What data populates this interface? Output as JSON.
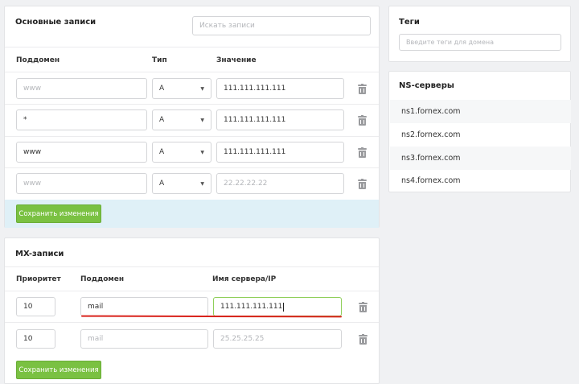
{
  "main_records": {
    "title": "Основные записи",
    "search_placeholder": "Искать записи",
    "columns": {
      "subdomain": "Поддомен",
      "type": "Тип",
      "value": "Значение"
    },
    "rows": [
      {
        "subdomain": "www",
        "subdomain_is_placeholder": true,
        "type": "A",
        "value": "111.111.111.111",
        "value_is_placeholder": false
      },
      {
        "subdomain": "*",
        "subdomain_is_placeholder": false,
        "type": "A",
        "value": "111.111.111.111",
        "value_is_placeholder": false
      },
      {
        "subdomain": "www",
        "subdomain_is_placeholder": false,
        "type": "A",
        "value": "111.111.111.111",
        "value_is_placeholder": false
      },
      {
        "subdomain": "www",
        "subdomain_is_placeholder": true,
        "type": "A",
        "value": "22.22.22.22",
        "value_is_placeholder": true
      }
    ],
    "save_label": "Сохранить изменения"
  },
  "mx_records": {
    "title": "MX-записи",
    "columns": {
      "priority": "Приоритет",
      "subdomain": "Поддомен",
      "server": "Имя сервера/IP"
    },
    "rows": [
      {
        "priority": "10",
        "subdomain": "mail",
        "subdomain_is_placeholder": false,
        "server": "111.111.111.111",
        "server_is_placeholder": false
      },
      {
        "priority": "10",
        "subdomain": "mail",
        "subdomain_is_placeholder": true,
        "server": "25.25.25.25",
        "server_is_placeholder": true
      }
    ],
    "save_label": "Сохранить изменения"
  },
  "tags": {
    "title": "Теги",
    "placeholder": "Введите теги для домена"
  },
  "ns_servers": {
    "title": "NS-серверы",
    "items": [
      "ns1.fornex.com",
      "ns2.fornex.com",
      "ns3.fornex.com",
      "ns4.fornex.com"
    ]
  },
  "colors": {
    "accent_green": "#7ac142",
    "save_row_bg": "#dff0f7",
    "annotation_underline": "#d9231c",
    "active_input_border": "#8fcf5a"
  }
}
